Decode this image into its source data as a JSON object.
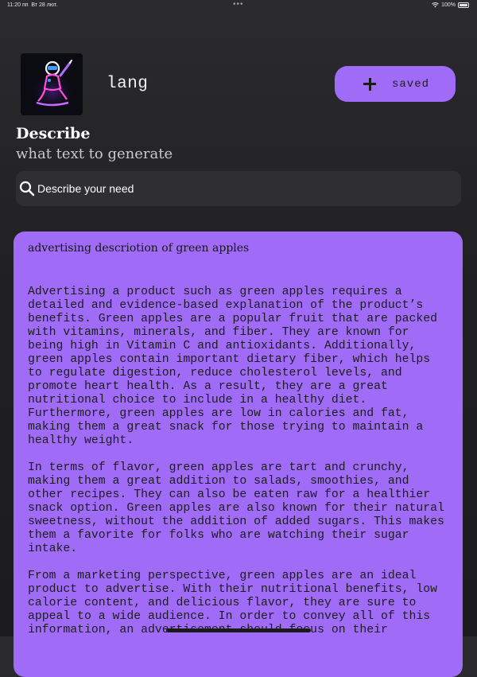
{
  "status_bar": {
    "time": "11:20 пп",
    "date": "Вт 28 лют.",
    "battery": "100%"
  },
  "app": {
    "name": "lang",
    "logo_icon": "robot-writing-icon"
  },
  "saved_button": {
    "label": "saved",
    "icon": "plus-icon"
  },
  "heading": "Describe",
  "subheading": "what text to generate",
  "search": {
    "placeholder": "Describe your need",
    "value": "",
    "icon": "search-icon"
  },
  "result": {
    "title": "advertising descriotion of green apples",
    "paragraphs": [
      "Advertising a product such as green apples requires a\ndetailed and evidence-based explanation of the product’s\nbenefits. Green apples are a popular fruit that are packed\nwith vitamins, minerals, and fiber. They are known for\nbeing high in Vitamin C and antioxidants. Additionally,\ngreen apples contain important dietary fiber, which helps\nto regulate digestion, reduce cholesterol levels, and\npromote heart health. As a result, they are a great\nnutritional choice to include in a healthy diet.\nFurthermore, green apples are low in calories and fat,\nmaking them a great snack for those trying to maintain a\nhealthy weight.",
      "In terms of flavor, green apples are tart and crunchy,\nmaking them a great addition to salads, smoothies, and\nother recipes. They can also be eaten raw for a healthier\nsnack option. Green apples are also known for their natural\nsweetness, without the addition of added sugars. This makes\nthem a favorite for folks who are watching their sugar\nintake.",
      "From a marketing perspective, green apples are an ideal\nproduct to advertise. With their nutritional benefits, low\ncalorie content, and delicious flavor, they are sure to\nappeal to a wide audience. In order to convey all of this\ninformation, an advertisement should focus on their"
    ]
  },
  "colors": {
    "accent": "#a06cf7",
    "background": "#1e1e20",
    "search_bg": "#2f2f32"
  }
}
